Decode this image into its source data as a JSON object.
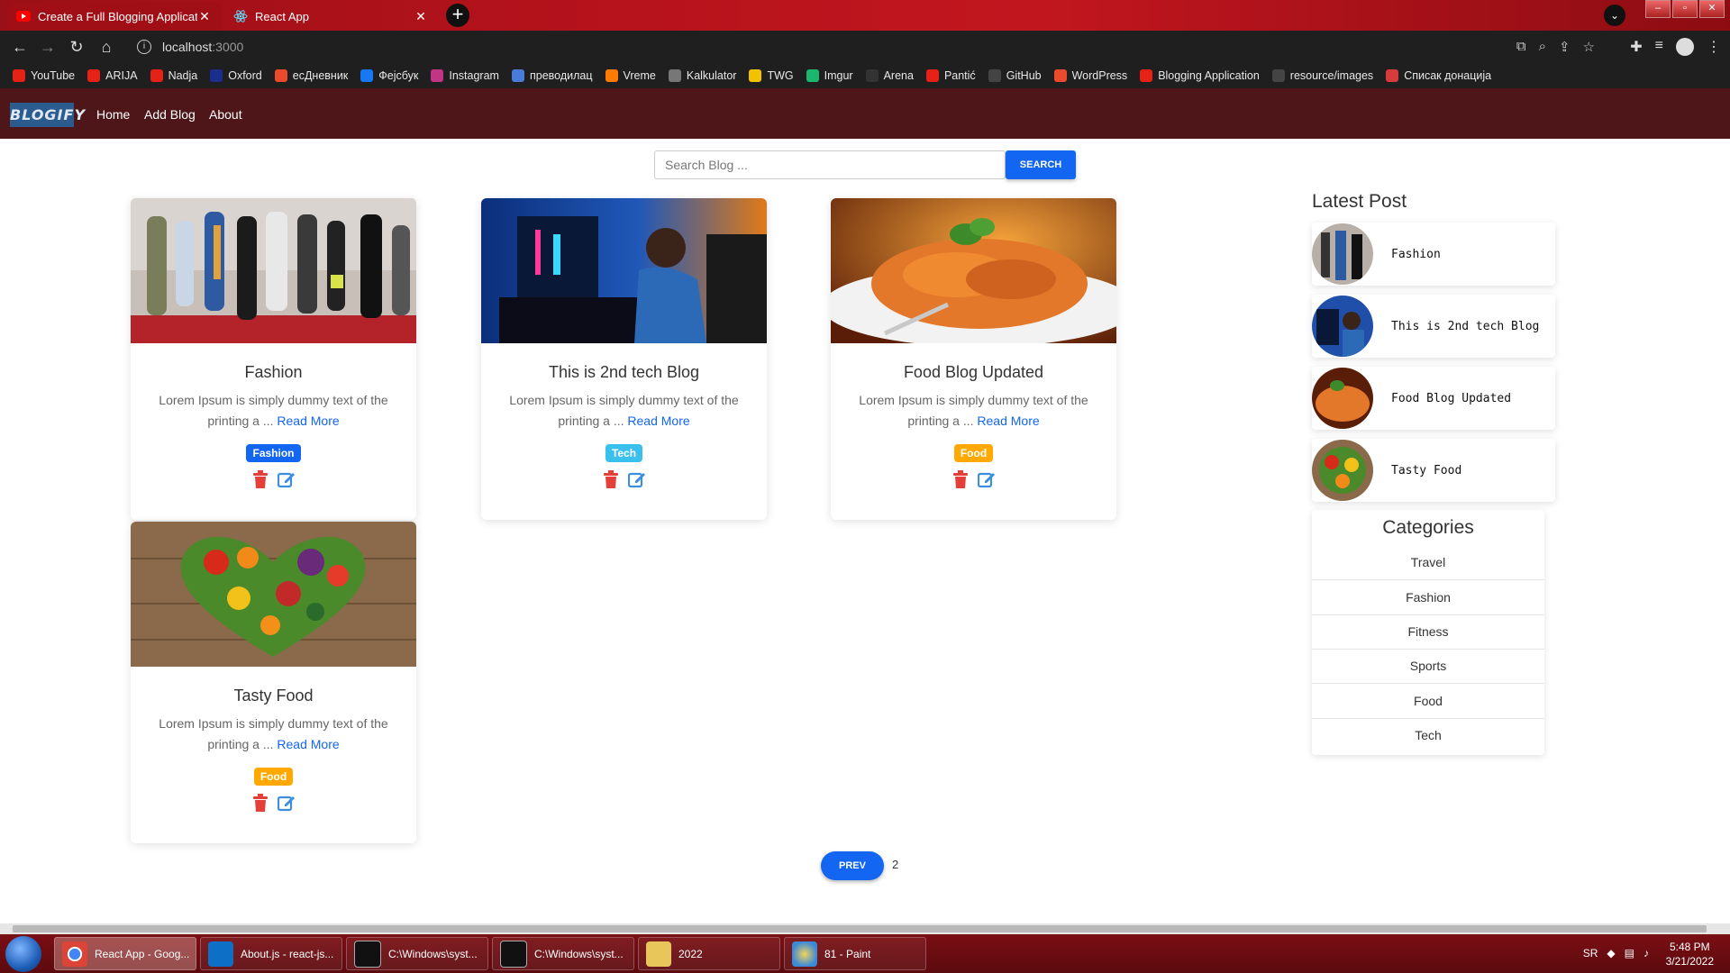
{
  "browser": {
    "tabs": [
      {
        "title": "Create a Full Blogging Applicatio",
        "active": true,
        "favicon": "youtube-icon"
      },
      {
        "title": "React App",
        "active": false,
        "favicon": "react-icon"
      }
    ],
    "url_host": "localhost",
    "url_port": ":3000",
    "bookmarks": [
      {
        "label": "YouTube",
        "color": "#e62117"
      },
      {
        "label": "ARIJA",
        "color": "#e62117"
      },
      {
        "label": "Nadja",
        "color": "#e62117"
      },
      {
        "label": "Oxford",
        "color": "#1a2e8f"
      },
      {
        "label": "есДневник",
        "color": "#e94b2c"
      },
      {
        "label": "Фејсбук",
        "color": "#1877f2"
      },
      {
        "label": "Instagram",
        "color": "#c13584"
      },
      {
        "label": "преводилац",
        "color": "#4a7bd8"
      },
      {
        "label": "Vreme",
        "color": "#ff7a00"
      },
      {
        "label": "Kalkulator",
        "color": "#777777"
      },
      {
        "label": "TWG",
        "color": "#f2c200"
      },
      {
        "label": "Imgur",
        "color": "#1bb76e"
      },
      {
        "label": "Arena",
        "color": "#333333"
      },
      {
        "label": "Pantić",
        "color": "#e62117"
      },
      {
        "label": "GitHub",
        "color": "#444444"
      },
      {
        "label": "WordPress",
        "color": "#e94b2c"
      },
      {
        "label": "Blogging Application",
        "color": "#e62117"
      },
      {
        "label": "resource/images",
        "color": "#444444"
      },
      {
        "label": "Списак донација",
        "color": "#d83b3b"
      }
    ]
  },
  "app": {
    "logo": "BLOGIFY",
    "nav": {
      "home": "Home",
      "add_blog": "Add Blog",
      "about": "About"
    },
    "search": {
      "placeholder": "Search Blog ...",
      "button": "SEARCH"
    },
    "read_more": "Read More",
    "blogs": [
      {
        "title": "Fashion",
        "desc": "Lorem Ipsum is simply dummy text of the printing a ... ",
        "category": "Fashion",
        "badge_color": "#1266f1"
      },
      {
        "title": "This is 2nd tech Blog",
        "desc": "Lorem Ipsum is simply dummy text of the printing a ... ",
        "category": "Tech",
        "badge_color": "#39c0ed"
      },
      {
        "title": "Food Blog Updated",
        "desc": "Lorem Ipsum is simply dummy text of the printing a ... ",
        "category": "Food",
        "badge_color": "#ffa900"
      },
      {
        "title": "Tasty Food",
        "desc": "Lorem Ipsum is simply dummy text of the printing a ... ",
        "category": "Food",
        "badge_color": "#ffa900"
      }
    ],
    "sidebar": {
      "latest_title": "Latest Post",
      "latest": [
        "Fashion",
        "This is 2nd tech Blog",
        "Food Blog Updated",
        "Tasty Food"
      ],
      "categories_title": "Categories",
      "categories": [
        "Travel",
        "Fashion",
        "Fitness",
        "Sports",
        "Food",
        "Tech"
      ]
    },
    "pagination": {
      "prev": "PREV",
      "page": "2"
    }
  },
  "taskbar": {
    "items": [
      "React App - Goog...",
      "About.js - react-js...",
      "C:\\Windows\\syst...",
      "C:\\Windows\\syst...",
      "2022",
      "81 - Paint"
    ],
    "lang": "SR",
    "time": "5:48 PM",
    "date": "3/21/2022"
  }
}
